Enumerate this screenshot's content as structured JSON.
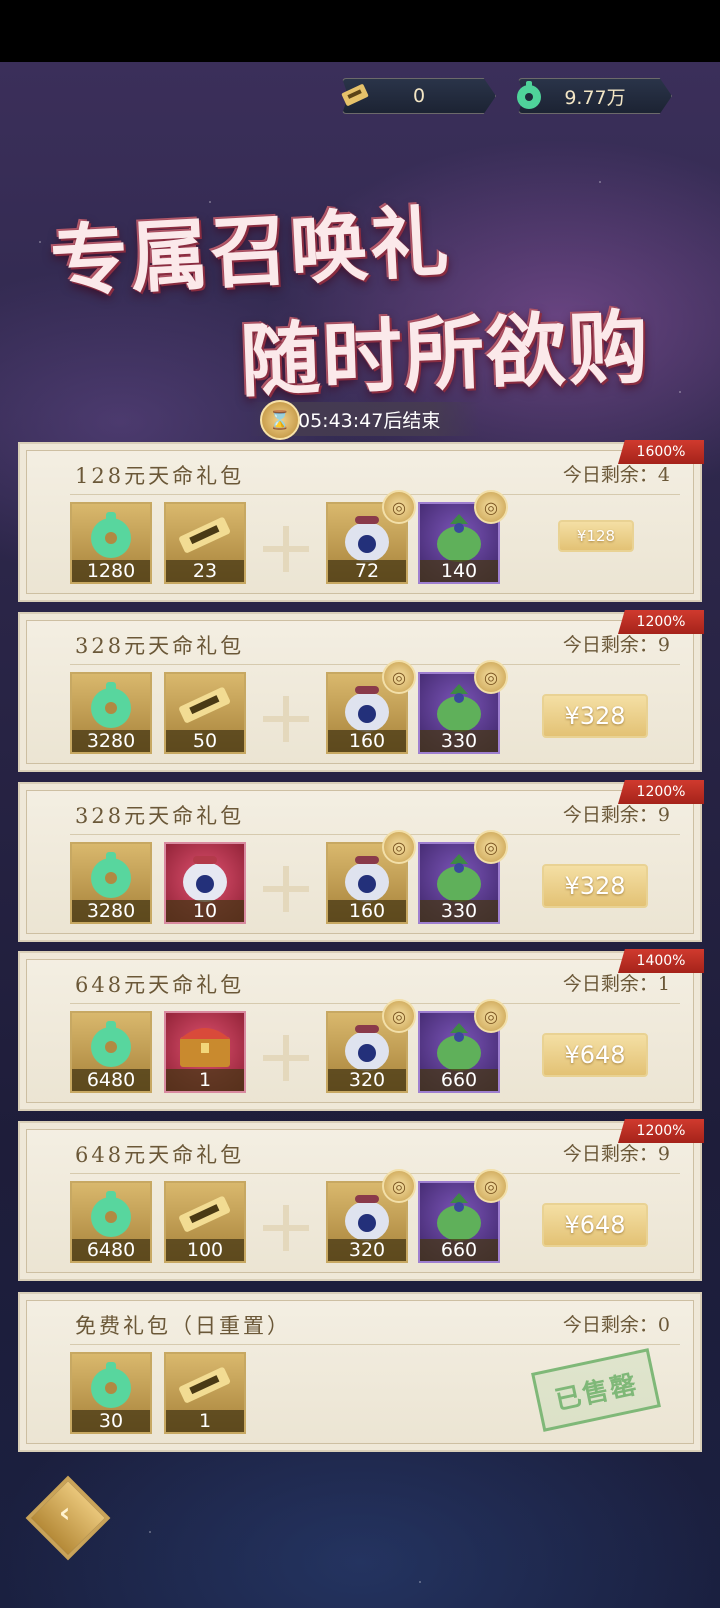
{
  "currency": {
    "ticket_value": "0",
    "jade_value": "9.77万"
  },
  "banner": {
    "title_line1": "专属召唤礼",
    "title_line2": "随时所欲购",
    "timer": "05:43:47后结束"
  },
  "cards": [
    {
      "title": "128元天命礼包",
      "remaining": "今日剩余：4",
      "badge": "1600%",
      "items": [
        {
          "count": "1280",
          "kind": "jade-icon"
        },
        {
          "count": "23",
          "kind": "ticket-icon"
        },
        {
          "count": "72",
          "kind": "lucky-bag-icon"
        },
        {
          "count": "140",
          "kind": "green-bag-icon"
        }
      ],
      "price": "¥128"
    },
    {
      "title": "328元天命礼包",
      "remaining": "今日剩余：9",
      "badge": "1200%",
      "items": [
        {
          "count": "3280",
          "kind": "jade-icon"
        },
        {
          "count": "50",
          "kind": "ticket-icon"
        },
        {
          "count": "160",
          "kind": "lucky-bag-icon"
        },
        {
          "count": "330",
          "kind": "green-bag-icon"
        }
      ],
      "price": "¥328"
    },
    {
      "title": "328元天命礼包",
      "remaining": "今日剩余：9",
      "badge": "1200%",
      "items": [
        {
          "count": "3280",
          "kind": "jade-icon"
        },
        {
          "count": "10",
          "kind": "red-lucky-bag-icon"
        },
        {
          "count": "160",
          "kind": "lucky-bag-icon"
        },
        {
          "count": "330",
          "kind": "green-bag-icon"
        }
      ],
      "price": "¥328"
    },
    {
      "title": "648元天命礼包",
      "remaining": "今日剩余：1",
      "badge": "1400%",
      "items": [
        {
          "count": "6480",
          "kind": "jade-icon"
        },
        {
          "count": "1",
          "kind": "treasure-chest-icon"
        },
        {
          "count": "320",
          "kind": "lucky-bag-icon"
        },
        {
          "count": "660",
          "kind": "green-bag-icon"
        }
      ],
      "price": "¥648"
    },
    {
      "title": "648元天命礼包",
      "remaining": "今日剩余：9",
      "badge": "1200%",
      "items": [
        {
          "count": "6480",
          "kind": "jade-icon"
        },
        {
          "count": "100",
          "kind": "ticket-icon"
        },
        {
          "count": "320",
          "kind": "lucky-bag-icon"
        },
        {
          "count": "660",
          "kind": "green-bag-icon"
        }
      ],
      "price": "¥648"
    }
  ],
  "free_card": {
    "title": "免费礼包（日重置）",
    "remaining": "今日剩余：0",
    "items": [
      {
        "count": "30",
        "kind": "jade-icon"
      },
      {
        "count": "1",
        "kind": "ticket-icon"
      }
    ],
    "sold_out": "已售罄"
  },
  "colors": {
    "accent_gold": "#d9b86d",
    "ribbon_red": "#c0302a",
    "card_bg": "#f2ecdf",
    "sold_green": "#7fb878"
  }
}
